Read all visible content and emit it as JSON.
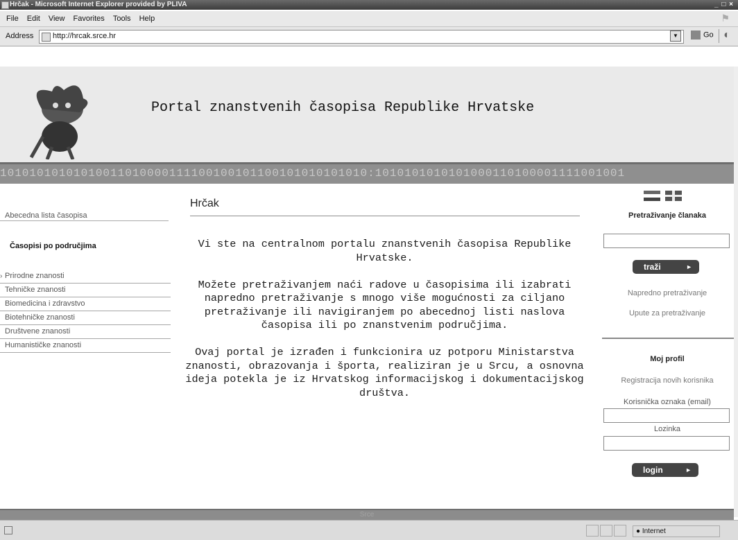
{
  "window": {
    "title": "Hrčak - Microsoft Internet Explorer provided by PLIVA",
    "controls": "_ □ ×"
  },
  "menu": [
    "File",
    "Edit",
    "View",
    "Favorites",
    "Tools",
    "Help"
  ],
  "address": {
    "label": "Address",
    "url": "http://hrcak.srce.hr",
    "go_label": "Go"
  },
  "header": {
    "title": "Portal znanstvenih časopisa Republike Hrvatske",
    "binary_strip": "10101010101010011010000111100100101100101010101010:1010101010101000110100001111001001"
  },
  "left": {
    "alpha_link": "Abecedna lista časopisa",
    "areas_heading": "Časopisi po područjima",
    "fields": [
      "Prirodne znanosti",
      "Tehničke znanosti",
      "Biomedicina i zdravstvo",
      "Biotehničke znanosti",
      "Društvene znanosti",
      "Humanističke znanosti"
    ]
  },
  "main": {
    "title": "Hrčak",
    "p1": "Vi ste na centralnom portalu znanstvenih časopisa Republike Hrvatske.",
    "p2": "Možete pretraživanjem naći radove u časopisima ili izabrati napredno pretraživanje s mnogo više mogućnosti za ciljano pretraživanje ili navigiranjem po abecednoj listi naslova časopisa ili po znanstvenim područjima.",
    "p3": "Ovaj portal je izrađen i funkcionira uz potporu Ministarstva znanosti, obrazovanja i športa, realiziran je u Srcu, a osnovna ideja potekla je iz Hrvatskog informacijskog i dokumentacijskog društva."
  },
  "right": {
    "search_heading": "Pretraživanje članaka",
    "search_button": "traži",
    "advanced_link": "Napredno pretraživanje",
    "help_link": "Upute za pretraživanje",
    "profile_heading": "Moj profil",
    "register_link": "Registracija novih korisnika",
    "user_label": "Korisnička oznaka (email)",
    "password_label": "Lozinka",
    "login_button": "login"
  },
  "footer": {
    "text": "Srce"
  },
  "status": {
    "zone": "Internet"
  }
}
